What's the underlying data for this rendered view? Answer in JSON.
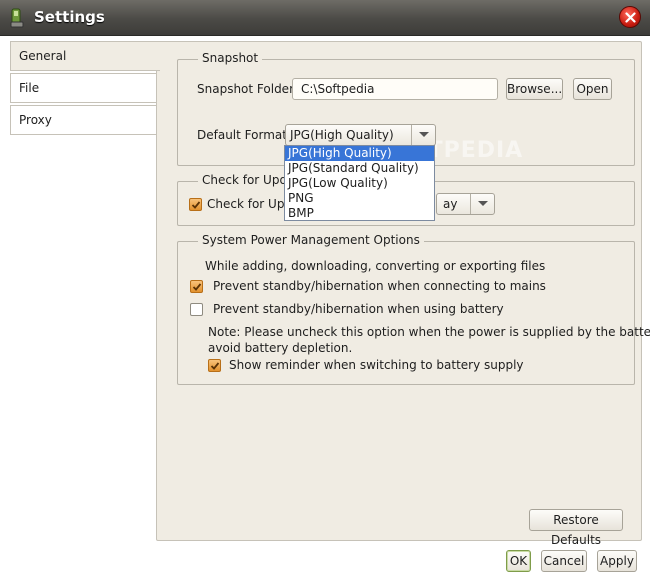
{
  "window": {
    "title": "Settings"
  },
  "tabs": [
    {
      "label": "General",
      "active": true
    },
    {
      "label": "File",
      "active": false
    },
    {
      "label": "Proxy",
      "active": false
    }
  ],
  "snapshot": {
    "group_title": "Snapshot",
    "folder_label": "Snapshot Folder:",
    "folder_value": "C:\\Softpedia",
    "browse_label": "Browse...",
    "open_label": "Open",
    "format_label": "Default Format:",
    "format_value": "JPG(High Quality)",
    "format_options": [
      "JPG(High Quality)",
      "JPG(Standard Quality)",
      "JPG(Low Quality)",
      "PNG",
      "BMP"
    ]
  },
  "updates": {
    "group_title": "Check for Upda",
    "check_label": "Check for Upda",
    "check_checked": true,
    "frequency_value": "ay"
  },
  "power": {
    "group_title": "System Power Management Options",
    "intro": "While adding, downloading, converting or exporting files",
    "mains_label": "Prevent standby/hibernation when connecting to mains",
    "mains_checked": true,
    "battery_label": "Prevent standby/hibernation when using battery",
    "battery_checked": false,
    "note_line1": "Note: Please uncheck this option when the power is supplied by the battery to",
    "note_line2": "avoid battery depletion.",
    "reminder_label": "Show reminder when switching to battery supply",
    "reminder_checked": true
  },
  "buttons": {
    "restore": "Restore Defaults",
    "ok": "OK",
    "cancel": "Cancel",
    "apply": "Apply"
  },
  "watermark": "SOFTPEDIA",
  "colors": {
    "titlebar": "#4b4a46",
    "panel": "#f0ece3",
    "selection": "#3875d7",
    "checkbox": "#e2922e",
    "close": "#c81c10"
  }
}
